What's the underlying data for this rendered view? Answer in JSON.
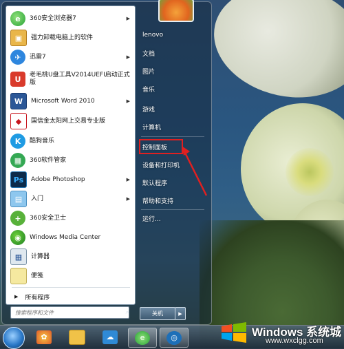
{
  "start_menu": {
    "programs": [
      {
        "label": "360安全浏览器7",
        "icon": "360-browser-icon",
        "arrow": "▶"
      },
      {
        "label": "强力卸载电脑上的软件",
        "icon": "uninstall-box-icon",
        "arrow": ""
      },
      {
        "label": "迅雷7",
        "icon": "xunlei-icon",
        "arrow": "▶"
      },
      {
        "label": "老毛桃U盘工具V2014UEFI启动正式版",
        "icon": "usb-tool-icon",
        "arrow": ""
      },
      {
        "label": "Microsoft Word 2010",
        "icon": "word-icon",
        "arrow": "▶"
      },
      {
        "label": "国信金太阳网上交易专业版",
        "icon": "stock-trading-icon",
        "arrow": ""
      },
      {
        "label": "酷狗音乐",
        "icon": "kugou-icon",
        "arrow": ""
      },
      {
        "label": "360软件管家",
        "icon": "360-software-manager-icon",
        "arrow": ""
      },
      {
        "label": "Adobe Photoshop",
        "icon": "photoshop-icon",
        "arrow": "▶"
      },
      {
        "label": "入门",
        "icon": "getting-started-icon",
        "arrow": "▶"
      },
      {
        "label": "360安全卫士",
        "icon": "360-security-icon",
        "arrow": ""
      },
      {
        "label": "Windows Media Center",
        "icon": "media-center-icon",
        "arrow": ""
      },
      {
        "label": "计算器",
        "icon": "calculator-icon",
        "arrow": ""
      },
      {
        "label": "便笺",
        "icon": "sticky-notes-icon",
        "arrow": ""
      }
    ],
    "all_programs_label": "所有程序",
    "search_placeholder": "搜索程序和文件",
    "right_items": [
      "lenovo",
      "文档",
      "图片",
      "音乐",
      "游戏",
      "计算机",
      "控制面板",
      "设备和打印机",
      "默认程序",
      "帮助和支持",
      "运行..."
    ],
    "highlighted_item": "控制面板",
    "shutdown_label": "关机",
    "shutdown_arrow": "▶",
    "highlight_color": "#e02020"
  },
  "taskbar": {
    "items": [
      {
        "name": "360-browser-taskbar-icon"
      },
      {
        "name": "file-explorer-taskbar-icon"
      },
      {
        "name": "cloud-taskbar-icon"
      },
      {
        "name": "360-browser-active-taskbar-icon"
      },
      {
        "name": "screenshot-taskbar-icon"
      }
    ]
  },
  "watermark": {
    "title": "Windows 系统城",
    "url": "www.wxclgg.com"
  }
}
